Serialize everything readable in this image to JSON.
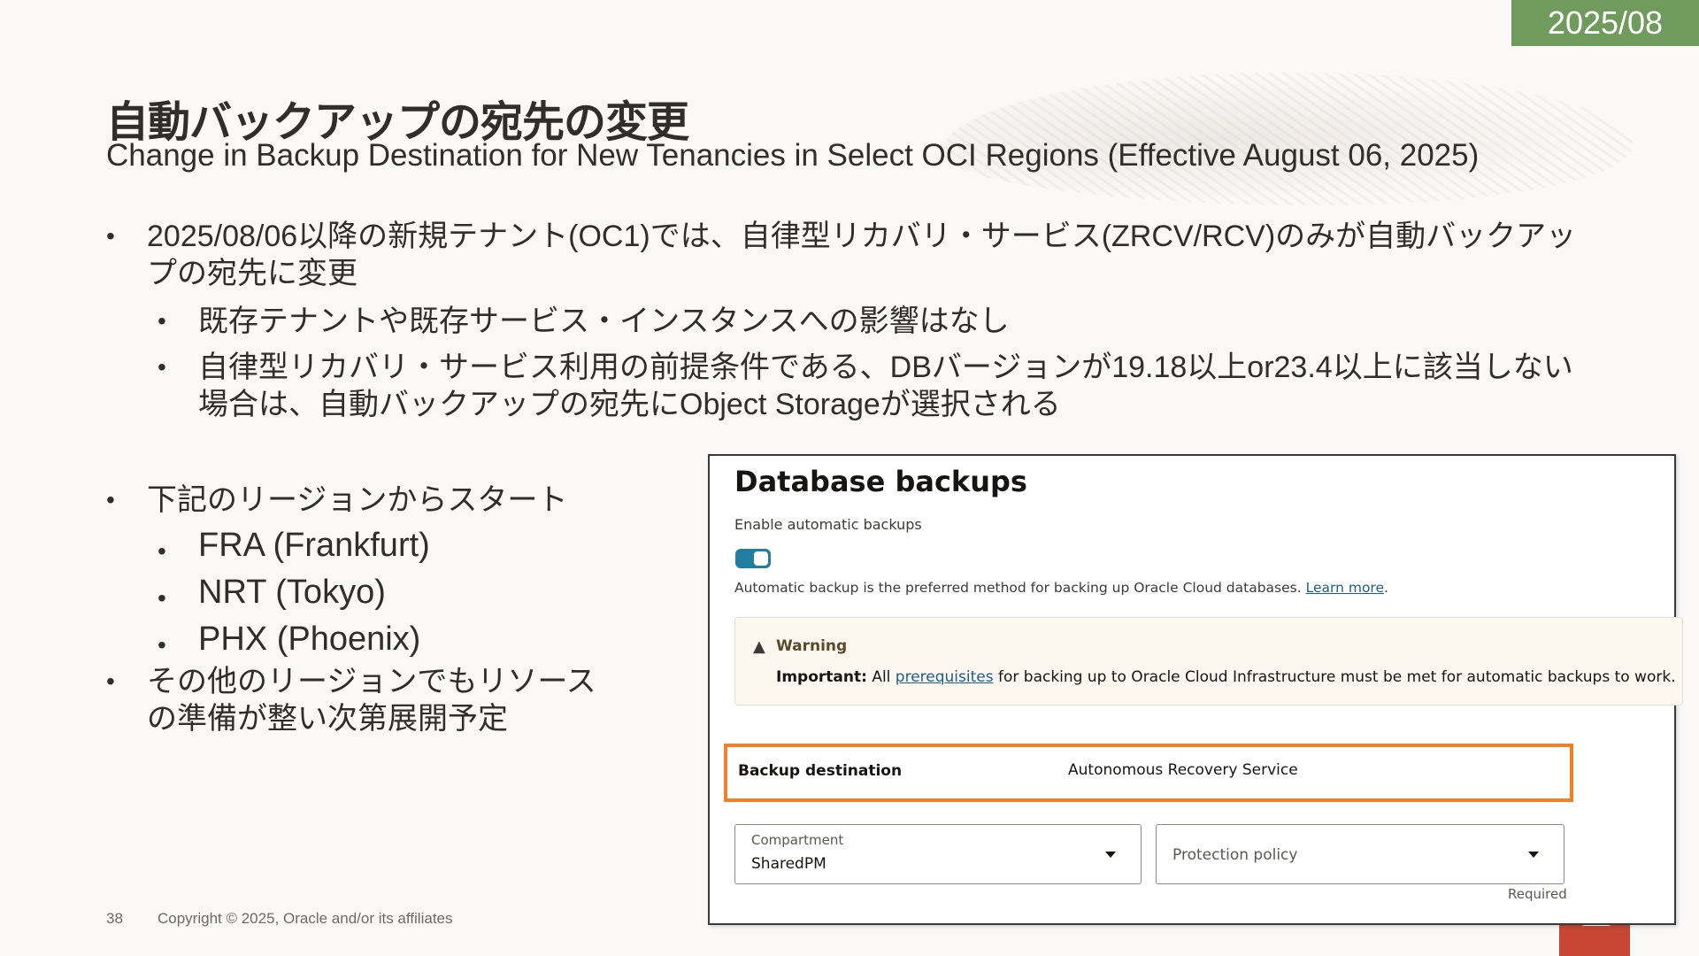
{
  "date_badge": "2025/08",
  "title_jp": "自動バックアップの宛先の変更",
  "title_en": "Change in Backup Destination for New Tenancies in Select OCI Regions (Effective August 06, 2025)",
  "bullets": [
    "2025/08/06以降の新規テナント(OC1)では、自律型リカバリ・サービス(ZRCV/RCV)のみが自動バックアップの宛先に変更",
    "既存テナントや既存サービス・インスタンスへの影響はなし",
    "自律型リカバリ・サービス利用の前提条件である、DBバージョンが19.18以上or23.4以上に該当しない場合は、自動バックアップの宛先にObject Storageが選択される"
  ],
  "regions_intro": "下記のリージョンからスタート",
  "regions": [
    "FRA (Frankfurt)",
    "NRT (Tokyo)",
    "PHX (Phoenix)"
  ],
  "regions_other": "その他のリージョンでもリソースの準備が整い次第展開予定",
  "footer": {
    "page_number": "38",
    "copyright": "Copyright © 2025, Oracle and/or its affiliates"
  },
  "panel": {
    "title": "Database backups",
    "enable_label": "Enable automatic backups",
    "toggle_on": true,
    "help_text": "Automatic backup is the preferred method for backing up Oracle Cloud databases.",
    "learn_more": "Learn more",
    "warning": {
      "icon": "warning-triangle-icon",
      "title": "Warning",
      "important_label": "Important:",
      "body_pre": "All",
      "link": "prerequisites",
      "body_post": "for backing up to Oracle Cloud Infrastructure must be met for automatic backups to work."
    },
    "backup_destination": {
      "label": "Backup destination",
      "value": "Autonomous Recovery Service"
    },
    "compartment": {
      "label": "Compartment",
      "value": "SharedPM"
    },
    "protection_policy": {
      "placeholder": "Protection policy"
    },
    "required": "Required"
  },
  "colors": {
    "badge": "#6f9c5c",
    "highlight": "#f0802a",
    "toggle": "#227e9e",
    "link": "#1f5d8f",
    "oracle_red": "#c74634"
  }
}
